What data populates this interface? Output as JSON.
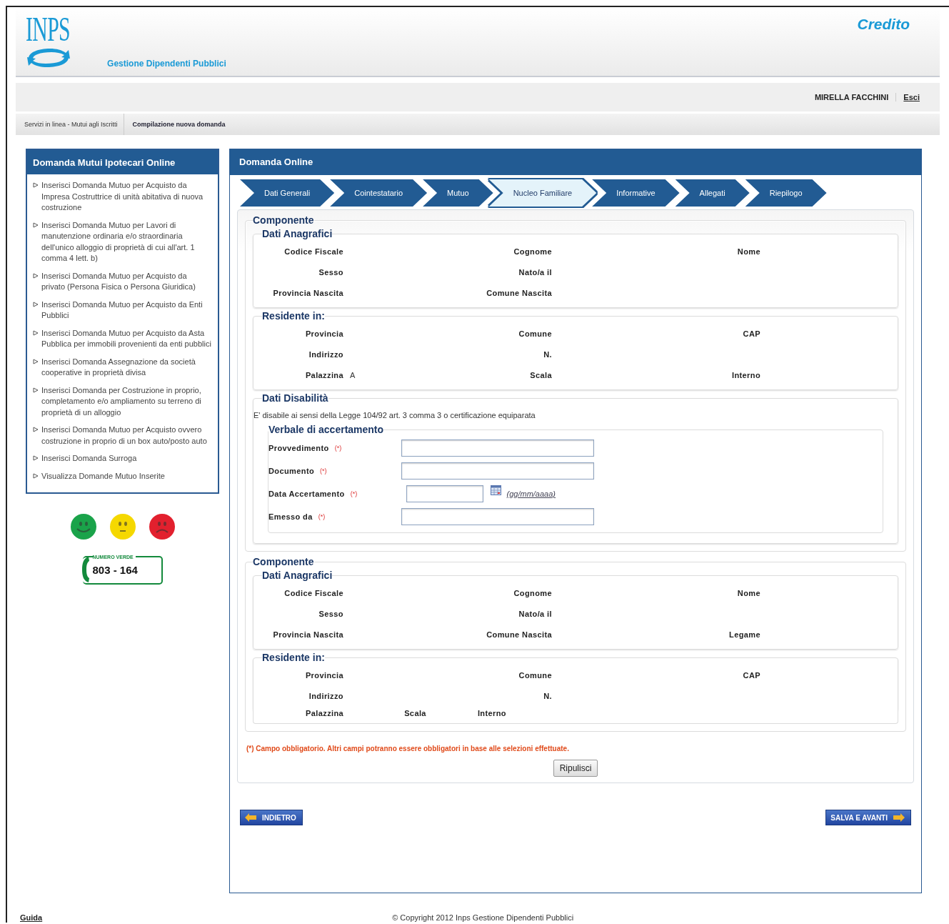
{
  "header": {
    "logo_text": "INPS",
    "subtitle": "Gestione Dipendenti Pubblici",
    "app_title": "Credito"
  },
  "user": {
    "name": "MIRELLA FACCHINI",
    "logout": "Esci"
  },
  "breadcrumb": [
    "Servizi in linea - Mutui agli Iscritti",
    "Compilazione nuova domanda"
  ],
  "sidebar": {
    "title": "Domanda Mutui Ipotecari Online",
    "items": [
      "Inserisci Domanda Mutuo per Acquisto da Impresa Costruttrice di unità abitativa di nuova costruzione",
      "Inserisci Domanda Mutuo per Lavori di manutenzione ordinaria e/o straordinaria dell'unico alloggio di proprietà di cui all'art. 1 comma 4 lett. b)",
      "Inserisci Domanda Mutuo per Acquisto da privato (Persona Fisica o Persona Giuridica)",
      "Inserisci Domanda Mutuo per Acquisto da Enti Pubblici",
      "Inserisci Domanda Mutuo per Acquisto da Asta Pubblica per immobili provenienti da enti pubblici",
      "Inserisci Domanda Assegnazione da società cooperative in proprietà divisa",
      "Inserisci Domanda per Costruzione in proprio, completamento e/o ampliamento su terreno di proprietà di un alloggio",
      "Inserisci Domanda Mutuo per Acquisto ovvero costruzione in proprio di un box auto/posto auto",
      "Inserisci Domanda Surroga",
      "Visualizza Domande Mutuo Inserite"
    ]
  },
  "toll_free": {
    "label": "NUMERO VERDE",
    "number": "803 - 164"
  },
  "main": {
    "title": "Domanda Online",
    "steps": [
      {
        "label": "Dati Generali",
        "selected": false
      },
      {
        "label": "Cointestatario",
        "selected": false
      },
      {
        "label": "Mutuo",
        "selected": false
      },
      {
        "label": "Nucleo Familiare",
        "selected": true
      },
      {
        "label": "Informative",
        "selected": false
      },
      {
        "label": "Allegati",
        "selected": false
      },
      {
        "label": "Riepilogo",
        "selected": false
      }
    ],
    "components": [
      {
        "title": "Componente",
        "sections": [
          {
            "kind": "grid",
            "title": "Dati Anagrafici",
            "rows": [
              [
                {
                  "label": "Codice Fiscale"
                },
                {
                  "label": "Cognome"
                },
                {
                  "label": "Nome"
                }
              ],
              [
                {
                  "label": "Sesso"
                },
                {
                  "label": "Nato/a il"
                }
              ],
              [
                {
                  "label": "Provincia Nascita"
                },
                {
                  "label": "Comune Nascita"
                }
              ]
            ]
          },
          {
            "kind": "grid",
            "title": "Residente in:",
            "rows": [
              [
                {
                  "label": "Provincia"
                },
                {
                  "label": "Comune"
                },
                {
                  "label": "CAP"
                }
              ],
              [
                {
                  "label": "Indirizzo"
                },
                {
                  "label": "N."
                }
              ],
              [
                {
                  "label": "Palazzina",
                  "value": "A"
                },
                {
                  "label": "Scala"
                },
                {
                  "label": "Interno"
                }
              ]
            ]
          },
          {
            "kind": "disability",
            "title": "Dati Disabilità",
            "text": "E' disabile ai sensi della Legge 104/92 art. 3 comma 3 o certificazione equiparata",
            "subtitle": "Verbale di accertamento",
            "fields": [
              {
                "kind": "text",
                "label": "Provvedimento",
                "required": "(*)"
              },
              {
                "kind": "text",
                "label": "Documento",
                "required": "(*)"
              },
              {
                "kind": "date",
                "label": "Data Accertamento",
                "required": "(*)",
                "hint": "(gg/mm/aaaa)"
              },
              {
                "kind": "text",
                "label": "Emesso da",
                "required": "(*)"
              }
            ]
          }
        ]
      },
      {
        "title": "Componente",
        "sections": [
          {
            "kind": "grid",
            "title": "Dati Anagrafici",
            "rows": [
              [
                {
                  "label": "Codice Fiscale"
                },
                {
                  "label": "Cognome"
                },
                {
                  "label": "Nome"
                }
              ],
              [
                {
                  "label": "Sesso"
                },
                {
                  "label": "Nato/a il"
                }
              ],
              [
                {
                  "label": "Provincia Nascita"
                },
                {
                  "label": "Comune Nascita"
                },
                {
                  "label": "Legame"
                }
              ]
            ]
          },
          {
            "kind": "grid",
            "title": "Residente in:",
            "rows": [
              [
                {
                  "label": "Provincia"
                },
                {
                  "label": "Comune"
                },
                {
                  "label": "CAP"
                }
              ],
              [
                {
                  "label": "Indirizzo"
                },
                {
                  "label": "N."
                }
              ]
            ]
          },
          {
            "kind": "inline",
            "labels": [
              "Palazzina",
              "Scala",
              "Interno"
            ]
          }
        ]
      }
    ],
    "note": "(*) Campo obbligatorio. Altri campi potranno essere obbligatori in base alle selezioni effettuate.",
    "reset_button": "Ripulisci",
    "back_button": "INDIETRO",
    "next_button": "SALVA E AVANTI"
  },
  "footer": {
    "help": "Guida",
    "copyright": "© Copyright 2012 Inps Gestione Dipendenti Pubblici"
  }
}
